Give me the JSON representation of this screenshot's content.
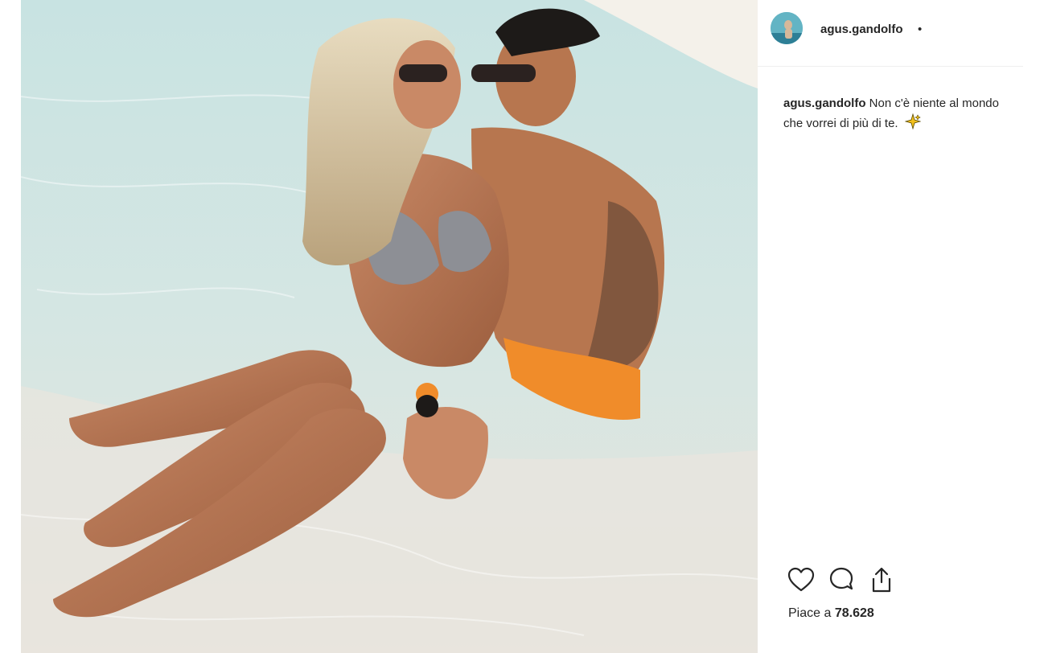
{
  "post": {
    "image_alt": "beach-photo",
    "header": {
      "username": "agus.gandolfo",
      "separator": "•"
    },
    "caption": {
      "username": "agus.gandolfo",
      "text": "Non c'è niente al mondo che vorrei di più di te."
    },
    "actions": {
      "like_icon": "heart-icon",
      "comment_icon": "comment-icon",
      "share_icon": "share-icon"
    },
    "likes": {
      "label": "Piace a",
      "count": "78.628"
    }
  }
}
